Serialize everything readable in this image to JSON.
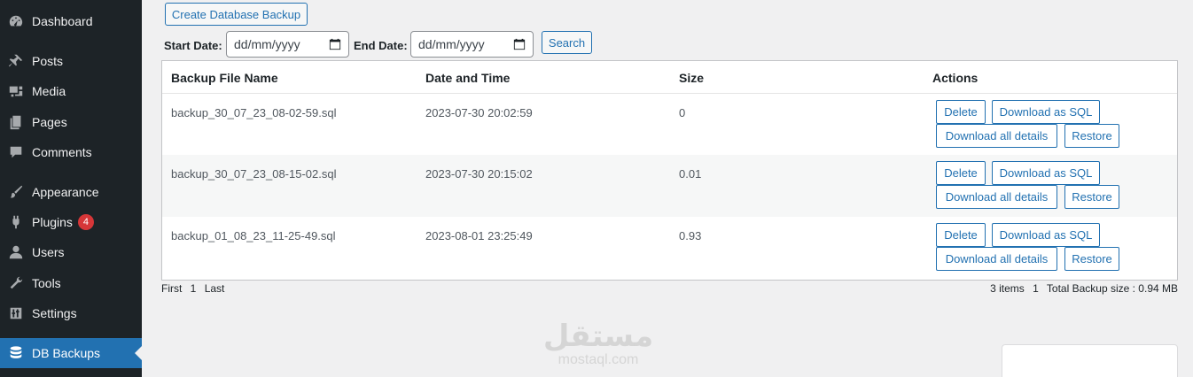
{
  "sidebar": {
    "items": [
      {
        "label": "Dashboard",
        "icon": "dashboard-icon"
      },
      {
        "label": "Posts",
        "icon": "pin-icon"
      },
      {
        "label": "Media",
        "icon": "media-icon"
      },
      {
        "label": "Pages",
        "icon": "pages-icon"
      },
      {
        "label": "Comments",
        "icon": "comment-icon"
      },
      {
        "label": "Appearance",
        "icon": "brush-icon"
      },
      {
        "label": "Plugins",
        "icon": "plug-icon",
        "badge": "4"
      },
      {
        "label": "Users",
        "icon": "user-icon"
      },
      {
        "label": "Tools",
        "icon": "wrench-icon"
      },
      {
        "label": "Settings",
        "icon": "settings-icon"
      },
      {
        "label": "DB Backups",
        "icon": "database-icon",
        "active": true
      }
    ]
  },
  "toolbar": {
    "create_label": "Create Database Backup",
    "start_label": "Start Date:",
    "end_label": "End Date:",
    "start_placeholder": "dd/mm/yyyy",
    "end_placeholder": "dd/mm/yyyy",
    "search_label": "Search"
  },
  "table": {
    "headers": [
      "Backup File Name",
      "Date and Time",
      "Size",
      "Actions"
    ],
    "actions": {
      "delete": "Delete",
      "download_sql": "Download as SQL",
      "download_all": "Download all details",
      "restore": "Restore"
    },
    "rows": [
      {
        "file": "backup_30_07_23_08-02-59.sql",
        "datetime": "2023-07-30 20:02:59",
        "size": "0"
      },
      {
        "file": "backup_30_07_23_08-15-02.sql",
        "datetime": "2023-07-30 20:15:02",
        "size": "0.01"
      },
      {
        "file": "backup_01_08_23_11-25-49.sql",
        "datetime": "2023-08-01 23:25:49",
        "size": "0.93"
      }
    ]
  },
  "pagination": {
    "first": "First",
    "page": "1",
    "last": "Last",
    "items": "3 items",
    "current": "1",
    "total": "Total Backup size : 0.94 MB"
  },
  "watermark": {
    "arabic": "مستقل",
    "latin": "mostaql.com"
  },
  "colors": {
    "sidebar_bg": "#1d2327",
    "accent": "#2271b1",
    "badge": "#d63638"
  }
}
